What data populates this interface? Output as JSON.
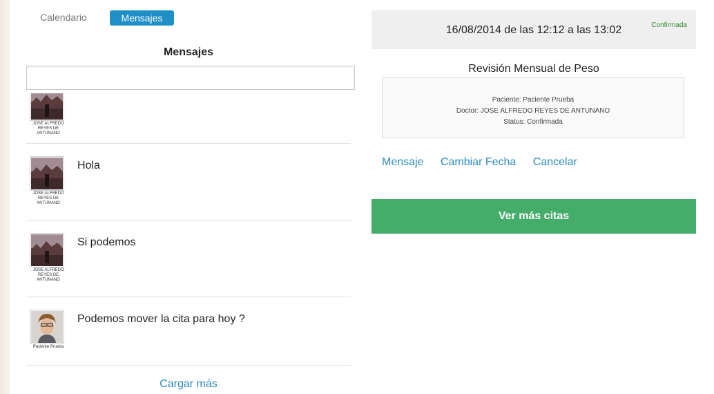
{
  "tabs": {
    "calendar_label": "Calendario",
    "messages_label": "Mensajes"
  },
  "messages_panel": {
    "title": "Mensajes",
    "input_placeholder": "",
    "load_more_label": "Cargar más",
    "items": [
      {
        "author": "JOSE ALFREDO REYES DE ANTUNANO",
        "text": "",
        "avatar": "landscape-avatar"
      },
      {
        "author": "JOSE ALFREDO REYES DE ANTUNANO",
        "text": "Hola",
        "avatar": "landscape-avatar"
      },
      {
        "author": "JOSE ALFREDO REYES DE ANTUNANO",
        "text": "Si podemos",
        "avatar": "landscape-avatar"
      },
      {
        "author": "Paciente Prueba",
        "text": "Podemos mover la cita para hoy ?",
        "avatar": "person-avatar"
      }
    ]
  },
  "appointment": {
    "date_text": "16/08/2014 de las 12:12 a las 13:02",
    "status_badge": "Confirmada",
    "title": "Revisión Mensual de Peso",
    "patient_line": "Paciente: Paciente Prueba",
    "doctor_line": "Doctor: JOSE ALFREDO REYES DE ANTUNANO",
    "status_line": "Status: Confirmada",
    "actions": {
      "message_label": "Mensaje",
      "change_date_label": "Cambiar Fecha",
      "cancel_label": "Cancelar"
    },
    "more_appointments_label": "Ver más citas"
  },
  "colors": {
    "accent_blue": "#1f8fc7",
    "link_blue": "#2a8bc0",
    "success_green": "#44ad69",
    "status_green": "#2e8b2e"
  }
}
